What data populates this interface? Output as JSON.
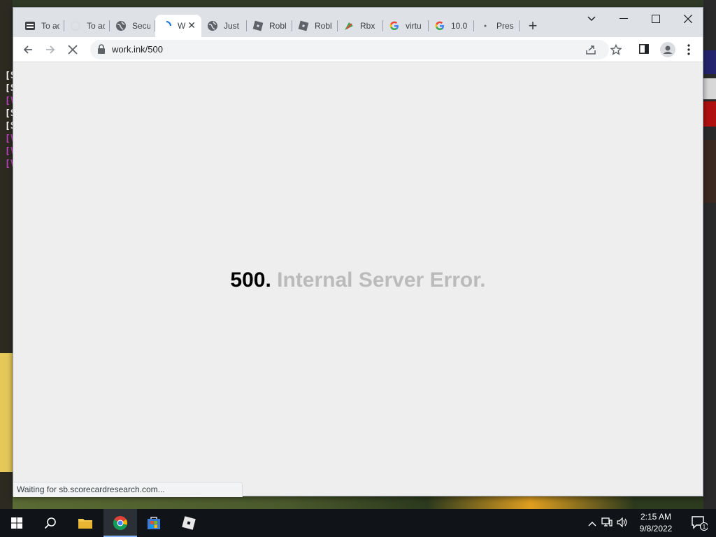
{
  "background_log": [
    "[S",
    "[S",
    "[V",
    "[S",
    "[S",
    "[V",
    "[V",
    "[V"
  ],
  "tabs": [
    {
      "title": "To ac",
      "icon": "app-icon"
    },
    {
      "title": "To ac",
      "icon": "loading-icon"
    },
    {
      "title": "Secu",
      "icon": "globe-icon"
    },
    {
      "title": "W",
      "icon": "loading-icon",
      "active": true
    },
    {
      "title": "Just",
      "icon": "globe-icon"
    },
    {
      "title": "Robl",
      "icon": "roblox-icon"
    },
    {
      "title": "Robl",
      "icon": "roblox-icon"
    },
    {
      "title": "Rbx",
      "icon": "rbx-icon"
    },
    {
      "title": "virtu",
      "icon": "google-icon"
    },
    {
      "title": "10.0",
      "icon": "google-icon"
    },
    {
      "title": "Pres",
      "icon": "loading-icon"
    }
  ],
  "address_bar": {
    "url": "work.ink/500"
  },
  "page": {
    "error_code": "500.",
    "error_text": "Internal Server Error."
  },
  "status_bar": {
    "text": "Waiting for sb.scorecardresearch.com..."
  },
  "taskbar": {
    "time": "2:15 AM",
    "date": "9/8/2022",
    "notification_count": "1"
  },
  "colors": {
    "accent": "#1a73e8",
    "error_code": "#000000",
    "error_text": "#bbbbbb",
    "page_bg": "#eeeeee"
  }
}
